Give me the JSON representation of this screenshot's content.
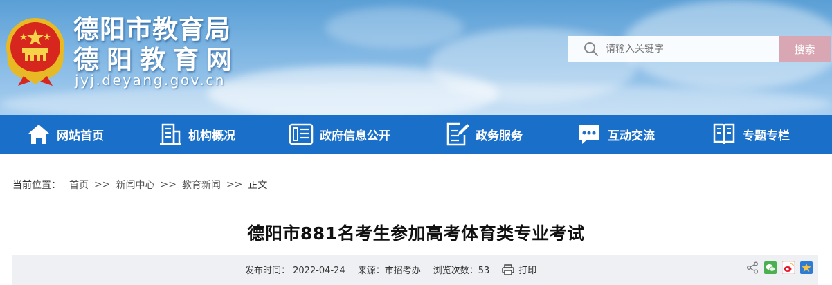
{
  "header": {
    "title_line1": "德阳市教育局",
    "title_line2": "德阳教育网",
    "domain": "jyj.deyang.gov.cn"
  },
  "search": {
    "placeholder": "请输入关键字",
    "button_label": "搜索"
  },
  "nav": {
    "items": [
      {
        "label": "网站首页",
        "icon": "home-icon"
      },
      {
        "label": "机构概况",
        "icon": "building-icon"
      },
      {
        "label": "政府信息公开",
        "icon": "document-list-icon"
      },
      {
        "label": "政务服务",
        "icon": "edit-document-icon"
      },
      {
        "label": "互动交流",
        "icon": "chat-icon"
      },
      {
        "label": "专题专栏",
        "icon": "book-icon"
      }
    ]
  },
  "breadcrumb": {
    "prefix": "当前位置：",
    "items": [
      "首页",
      "新闻中心",
      "教育新闻"
    ],
    "separator": ">>",
    "current": "正文"
  },
  "article": {
    "title": "德阳市881名考生参加高考体育类专业考试",
    "publish_time": "发布时间： 2022-04-24",
    "source": "来源：市招考办",
    "views": "浏览次数：53",
    "print_label": "打印"
  },
  "colors": {
    "nav_bg": "#1a6fc9",
    "search_button": "#d9a7b4",
    "meta_bg": "#eef0f4"
  }
}
